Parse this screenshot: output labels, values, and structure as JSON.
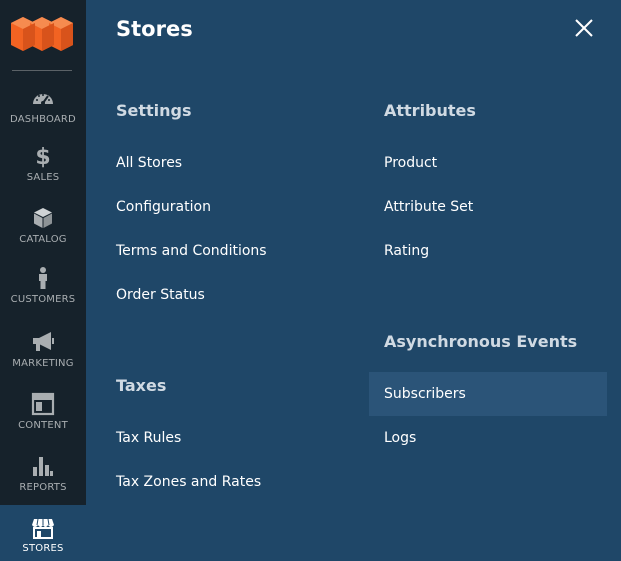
{
  "sidebar": {
    "logo_icon": "magento-logo-icon",
    "items": [
      {
        "label": "DASHBOARD",
        "icon": "speedometer-icon"
      },
      {
        "label": "SALES",
        "icon": "dollar-icon"
      },
      {
        "label": "CATALOG",
        "icon": "cube-icon"
      },
      {
        "label": "CUSTOMERS",
        "icon": "person-icon"
      },
      {
        "label": "MARKETING",
        "icon": "megaphone-icon"
      },
      {
        "label": "CONTENT",
        "icon": "layout-icon"
      },
      {
        "label": "REPORTS",
        "icon": "bar-chart-icon"
      },
      {
        "label": "STORES",
        "icon": "storefront-icon",
        "active": true
      }
    ]
  },
  "panel": {
    "title": "Stores",
    "close_icon": "close-icon",
    "sections": {
      "settings": {
        "title": "Settings",
        "links": [
          "All Stores",
          "Configuration",
          "Terms and Conditions",
          "Order Status"
        ]
      },
      "taxes": {
        "title": "Taxes",
        "links": [
          "Tax Rules",
          "Tax Zones and Rates"
        ]
      },
      "attributes": {
        "title": "Attributes",
        "links": [
          "Product",
          "Attribute Set",
          "Rating"
        ]
      },
      "async_events": {
        "title": "Asynchronous Events",
        "links": [
          "Subscribers",
          "Logs"
        ],
        "highlighted": "Subscribers"
      }
    }
  },
  "colors": {
    "sidebar_bg": "#16222b",
    "panel_bg": "#1f4768",
    "highlight_bg": "#2b5478",
    "logo_orange": "#f26322"
  }
}
